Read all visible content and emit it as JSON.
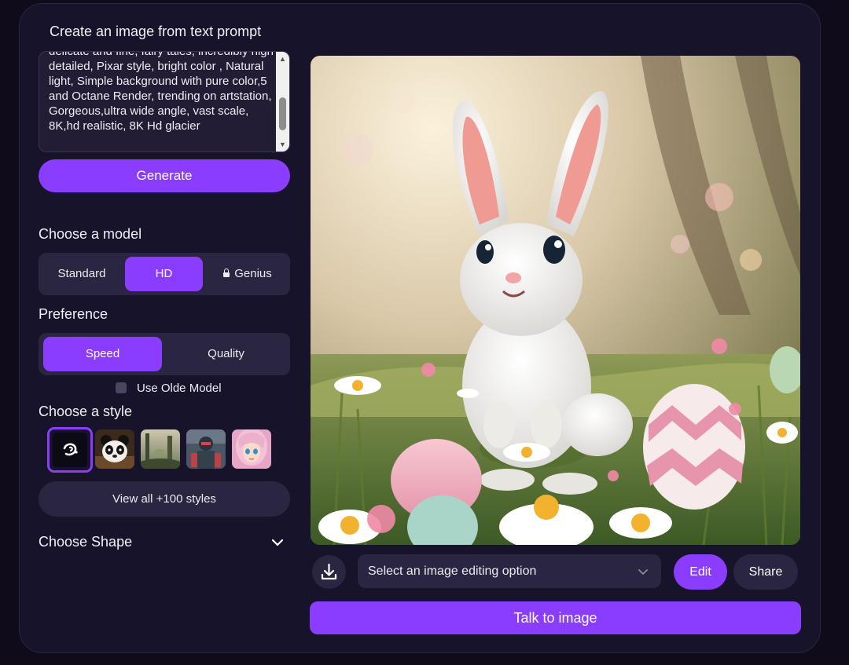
{
  "header": {
    "title": "Create an image from text prompt"
  },
  "prompt": {
    "text": "delicate and fine, fairy tales, incredibly high detailed, Pixar style, bright color , Natural light, Simple background with pure color,5 and Octane Render, trending on artstation, Gorgeous,ultra wide angle, vast scale, 8K,hd realistic, 8K Hd glacier"
  },
  "generate": {
    "label": "Generate"
  },
  "model": {
    "heading": "Choose a model",
    "options": [
      {
        "label": "Standard"
      },
      {
        "label": "HD"
      },
      {
        "label": "Genius"
      }
    ],
    "selected": "HD"
  },
  "preference": {
    "heading": "Preference",
    "options": [
      {
        "label": "Speed"
      },
      {
        "label": "Quality"
      }
    ],
    "selected": "Speed"
  },
  "old_model": {
    "label": "Use Olde Model",
    "checked": false
  },
  "style": {
    "heading": "Choose a style",
    "view_all_label": "View all +100 styles"
  },
  "shape": {
    "heading": "Choose Shape"
  },
  "editing": {
    "placeholder": "Select an image editing option",
    "edit_label": "Edit",
    "share_label": "Share",
    "talk_label": "Talk to image"
  },
  "colors": {
    "accent": "#8b3dff",
    "panel": "#17132a",
    "control": "#2a2540",
    "background": "#0f0b1b"
  },
  "icons": {
    "download": "download-icon",
    "select_chevron": "chevron-down-icon",
    "shape_chevron": "chevron-down-icon",
    "genius_lock": "lock-icon",
    "selected_style": "sparkle-swirl-icon"
  }
}
